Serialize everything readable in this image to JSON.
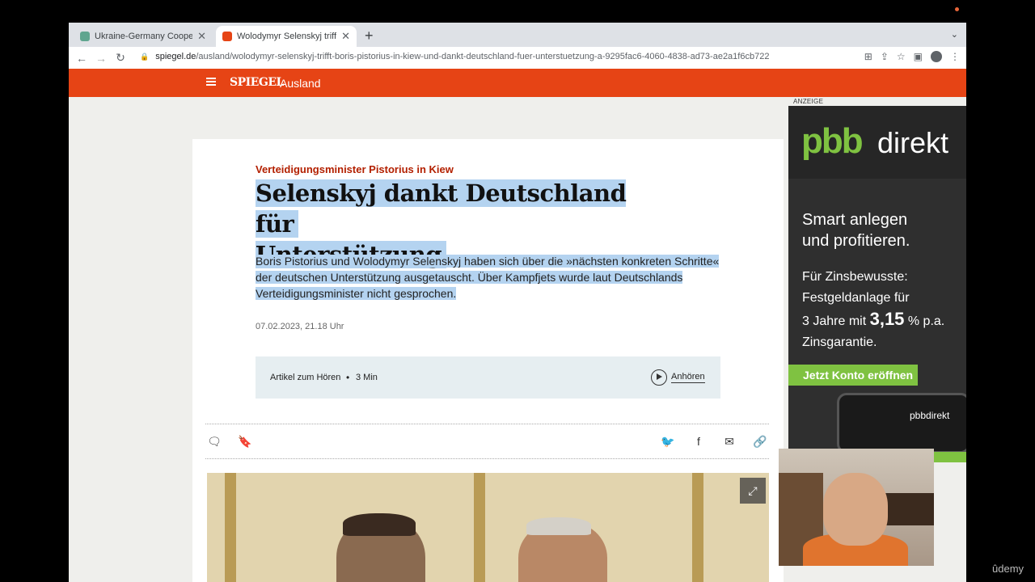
{
  "browser": {
    "tabs": [
      {
        "title": "Ukraine-Germany Cooperation",
        "active": false,
        "favicon_color": "#5fa58f"
      },
      {
        "title": "Wolodymyr Selenskyj trifft Bor",
        "active": true,
        "favicon_color": "#e64415"
      }
    ],
    "url_domain": "spiegel.de",
    "url_path": "/ausland/wolodymyr-selenskyj-trifft-boris-pistorius-in-kiew-und-dankt-deutschland-fuer-unterstuetzung-a-9295fac6-4060-4838-ad73-ae2a1f6cb722",
    "icons": [
      "back-icon",
      "forward-icon",
      "reload-icon",
      "lock-icon",
      "translate-icon",
      "share-icon",
      "star-icon",
      "sidebar-icon",
      "profile-icon",
      "menu-icon"
    ]
  },
  "site": {
    "brand": "SPIEGEL",
    "section": "Ausland",
    "header_color": "#e64415"
  },
  "article": {
    "kicker": "Verteidigungsminister Pistorius in Kiew",
    "headline_line1": "Selenskyj dankt Deutschland für",
    "headline_line2": "Unterstützung",
    "lead": "Boris Pistorius und Wolodymyr Selenskyj haben sich über die »nächsten konkreten Schritte« der deutschen Unterstützung ausgetauscht. Über Kampfjets wurde laut Deutschlands Verteidigungsminister nicht gesprochen.",
    "date": "07.02.2023, 21.18 Uhr",
    "audio": {
      "label": "Artikel zum Hören",
      "separator": "•",
      "duration": "3 Min",
      "listen": "Anhören"
    },
    "share_icons": [
      "comment-icon",
      "bookmark-icon",
      "twitter-icon",
      "facebook-icon",
      "mail-icon",
      "link-icon"
    ]
  },
  "ad": {
    "label": "ANZEIGE",
    "logo_left": "pbb",
    "logo_right": "direkt",
    "slogan_line1": "Smart anlegen",
    "slogan_line2": "und profitieren.",
    "copy_line1": "Für Zinsbewusste:",
    "copy_line2": "Festgeldanlage für",
    "copy_line3_pre": "3 Jahre mit",
    "copy_rate": "3,15",
    "copy_line3_post": "% p.a.",
    "copy_line4": "Zinsgarantie.",
    "cta": "Jetzt Konto eröffnen",
    "phone_logo": "pbbdirekt",
    "accent_color": "#7fc241"
  },
  "watermark": "ûdemy"
}
